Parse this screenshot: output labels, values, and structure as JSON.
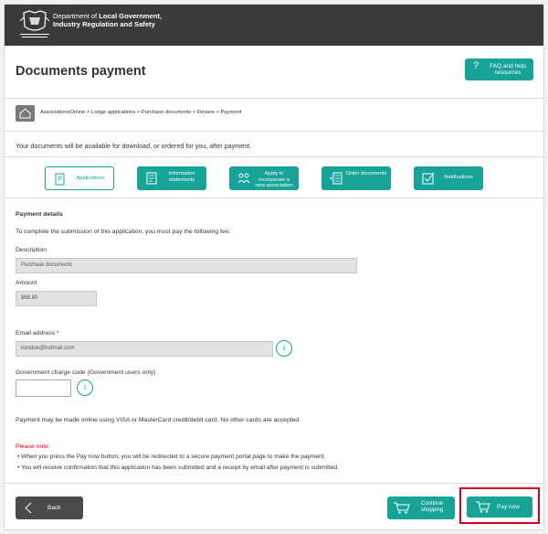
{
  "header": {
    "dept_line1_prefix": "Department of ",
    "dept_line1_bold": "Local Government,",
    "dept_line2": "Industry Regulation and Safety",
    "crest_caption": "GOVERNMENT OF WESTERN AUSTRALIA"
  },
  "page": {
    "title": "Documents payment",
    "faq_label": "FAQ and help resources"
  },
  "breadcrumb": {
    "text": "AssociationsOnline > Lodge applications > Purchase documents > Review > Payment"
  },
  "intro": "Your documents will be available for download, or ordered for you, after payment.",
  "nav": {
    "applications": "Applications",
    "information_statements": "Information statements",
    "apply_incorporate": "Apply to incorporate a new association",
    "order_documents": "Order documents",
    "notifications": "Notifications"
  },
  "payment": {
    "section_title": "Payment details",
    "instruction": "To complete the submission of this application, you must pay the following fee:",
    "description_label": "Description",
    "description_value": "Purchase documents",
    "amount_label": "Amount",
    "amount_value": "$68.80",
    "email_label": "Email address",
    "email_required": "*",
    "email_value": "tomdoe@hotmail.com",
    "gov_code_label": "Government charge code (Government users only)",
    "gov_code_value": "",
    "info_symbol": "i",
    "cards_note": "Payment may be made online using VISA or MasterCard credit/debit card. No other cards are accepted."
  },
  "note": {
    "title": "Please note:",
    "bullet1": "• When you press the Pay now button, you will be redirected to a secure payment portal page to make the payment.",
    "bullet2": "• You will receive confirmation that this application has been submitted and a receipt by email after payment is submitted."
  },
  "footer": {
    "back_label": "Back",
    "continue_label": "Continue shopping",
    "pay_label": "Pay now"
  },
  "colors": {
    "accent": "#17a398",
    "topbar": "#3a3a3a",
    "highlight": "#d0021b"
  }
}
